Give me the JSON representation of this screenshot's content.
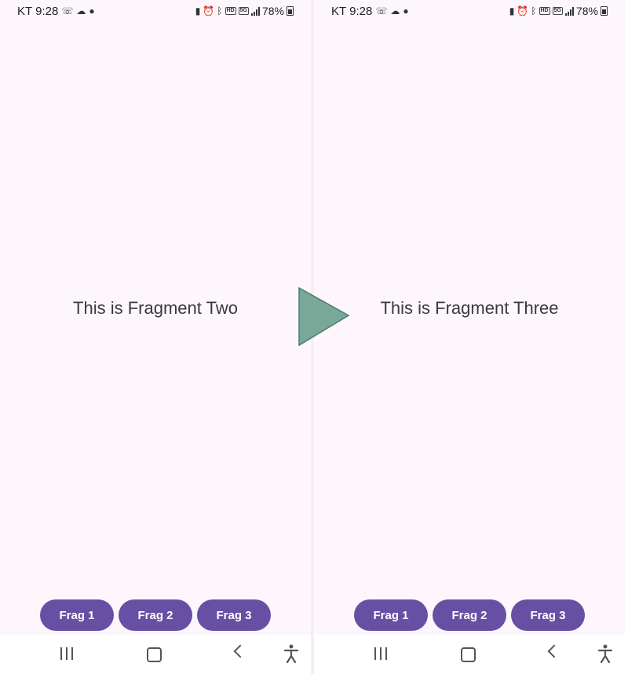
{
  "screens": [
    {
      "status": {
        "carrier": "KT",
        "time": "9:28",
        "network": "5G",
        "hd": "HD",
        "battery": "78%"
      },
      "message": "This is Fragment Two",
      "buttons": [
        "Frag 1",
        "Frag 2",
        "Frag 3"
      ]
    },
    {
      "status": {
        "carrier": "KT",
        "time": "9:28",
        "network": "5G",
        "hd": "HD",
        "battery": "78%"
      },
      "message": "This is Fragment Three",
      "buttons": [
        "Frag 1",
        "Frag 2",
        "Frag 3"
      ]
    }
  ],
  "colors": {
    "background": "#fdf7fd",
    "button": "#6750a4",
    "button_text": "#ffffff",
    "arrow": "#78a898"
  },
  "icons": [
    "wifi-call-icon",
    "cloud-icon",
    "chat-icon",
    "battery-saver-icon",
    "alarm-icon",
    "bluetooth-icon",
    "hd-icon",
    "5g-icon",
    "signal-icon",
    "battery-icon",
    "recents-icon",
    "home-icon",
    "back-icon",
    "accessibility-icon",
    "play-arrow-icon"
  ]
}
